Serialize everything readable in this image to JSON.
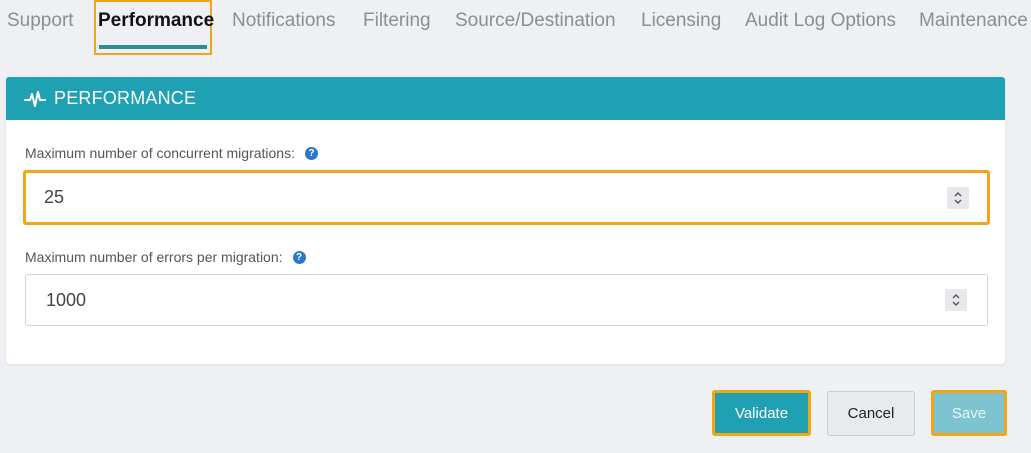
{
  "tabs": [
    {
      "label": "Support",
      "active": false
    },
    {
      "label": "Performance",
      "active": true
    },
    {
      "label": "Notifications",
      "active": false
    },
    {
      "label": "Filtering",
      "active": false
    },
    {
      "label": "Source/Destination",
      "active": false
    },
    {
      "label": "Licensing",
      "active": false
    },
    {
      "label": "Audit Log Options",
      "active": false
    },
    {
      "label": "Maintenance",
      "active": false
    }
  ],
  "panel": {
    "title": "PERFORMANCE",
    "icon": "pulse-icon",
    "header_color": "#1fa0b3"
  },
  "fields": {
    "concurrent": {
      "label": "Maximum number of concurrent migrations:",
      "value": "25"
    },
    "errors": {
      "label": "Maximum number of errors per migration:",
      "value": "1000"
    }
  },
  "help_glyph": "?",
  "buttons": {
    "validate": "Validate",
    "cancel": "Cancel",
    "save": "Save"
  },
  "colors": {
    "accent": "#1fa0b3",
    "highlight": "#f2a516",
    "help": "#2a78c8"
  }
}
